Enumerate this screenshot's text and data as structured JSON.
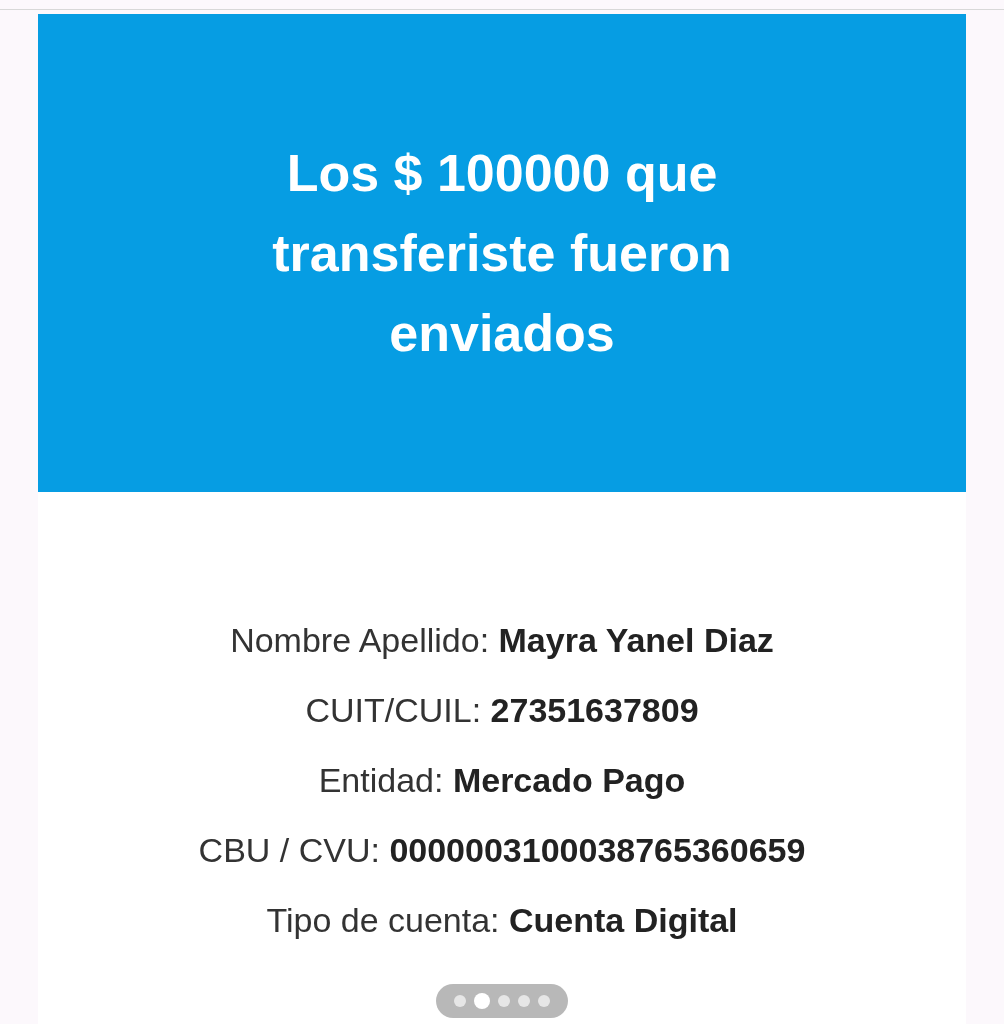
{
  "banner": {
    "title": "Los $ 100000 que transferiste fueron enviados"
  },
  "details": [
    {
      "label": "Nombre Apellido:",
      "value": "Mayra Yanel Diaz"
    },
    {
      "label": "CUIT/CUIL:",
      "value": "27351637809"
    },
    {
      "label": "Entidad:",
      "value": "Mercado Pago"
    },
    {
      "label": "CBU / CVU:",
      "value": "0000003100038765360659"
    },
    {
      "label": "Tipo de cuenta:",
      "value": "Cuenta Digital"
    }
  ],
  "page_dots": [
    {
      "selected": false
    },
    {
      "selected": true
    },
    {
      "selected": false
    },
    {
      "selected": false
    },
    {
      "selected": false
    }
  ]
}
